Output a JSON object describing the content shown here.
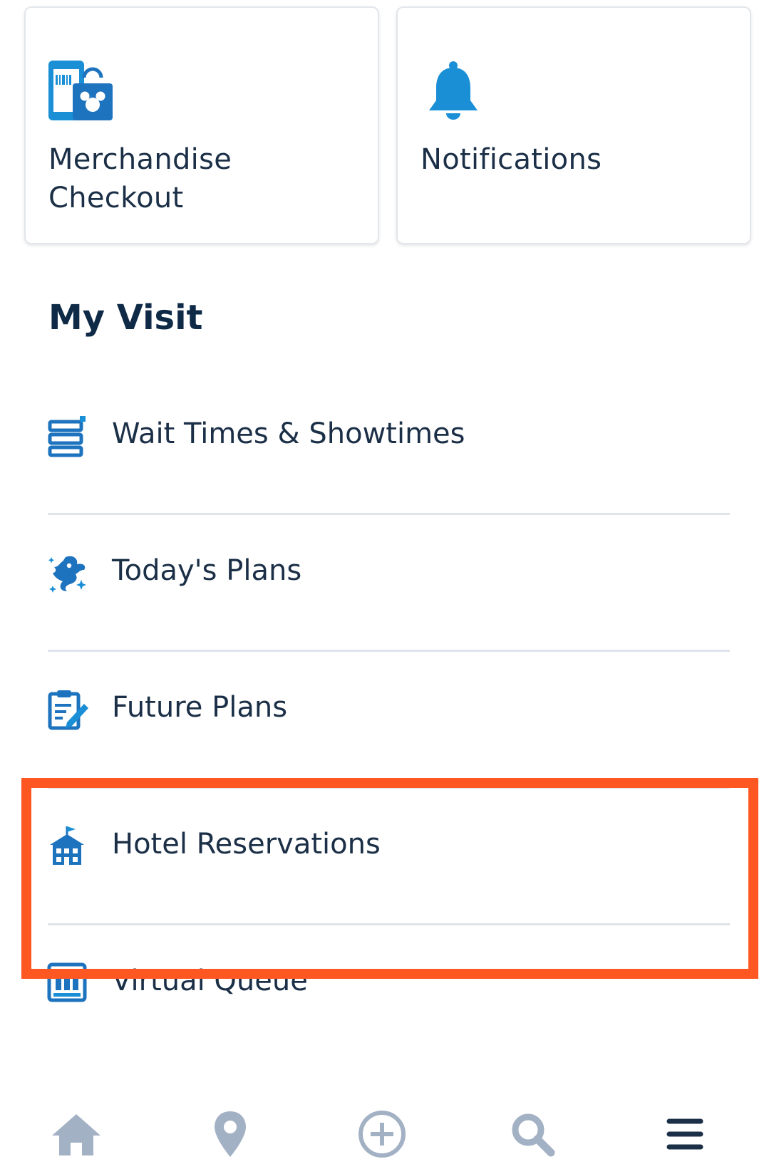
{
  "shortcuts": [
    {
      "label": "Merchandise Checkout",
      "icon": "merchandise-bag-icon"
    },
    {
      "label": "Notifications",
      "icon": "bell-icon"
    }
  ],
  "section_title": "My Visit",
  "menu_items": [
    {
      "label": "Wait Times & Showtimes",
      "icon": "wait-times-list-icon"
    },
    {
      "label": "Today's Plans",
      "icon": "genie-icon"
    },
    {
      "label": "Future Plans",
      "icon": "clipboard-edit-icon"
    },
    {
      "label": "Hotel Reservations",
      "icon": "hotel-icon",
      "highlighted": true
    },
    {
      "label": "Virtual Queue",
      "icon": "virtual-queue-icon"
    }
  ],
  "tab_bar": [
    {
      "icon": "home-icon"
    },
    {
      "icon": "map-pin-icon"
    },
    {
      "icon": "add-circle-icon"
    },
    {
      "icon": "search-icon"
    },
    {
      "icon": "menu-icon"
    }
  ],
  "colors": {
    "accent": "#1a8fd6",
    "icon_dark": "#1e73be",
    "text": "#1b2f47",
    "highlight": "#ff5722",
    "tab_inactive": "#a3b1c4",
    "tab_active": "#1b2f47"
  }
}
